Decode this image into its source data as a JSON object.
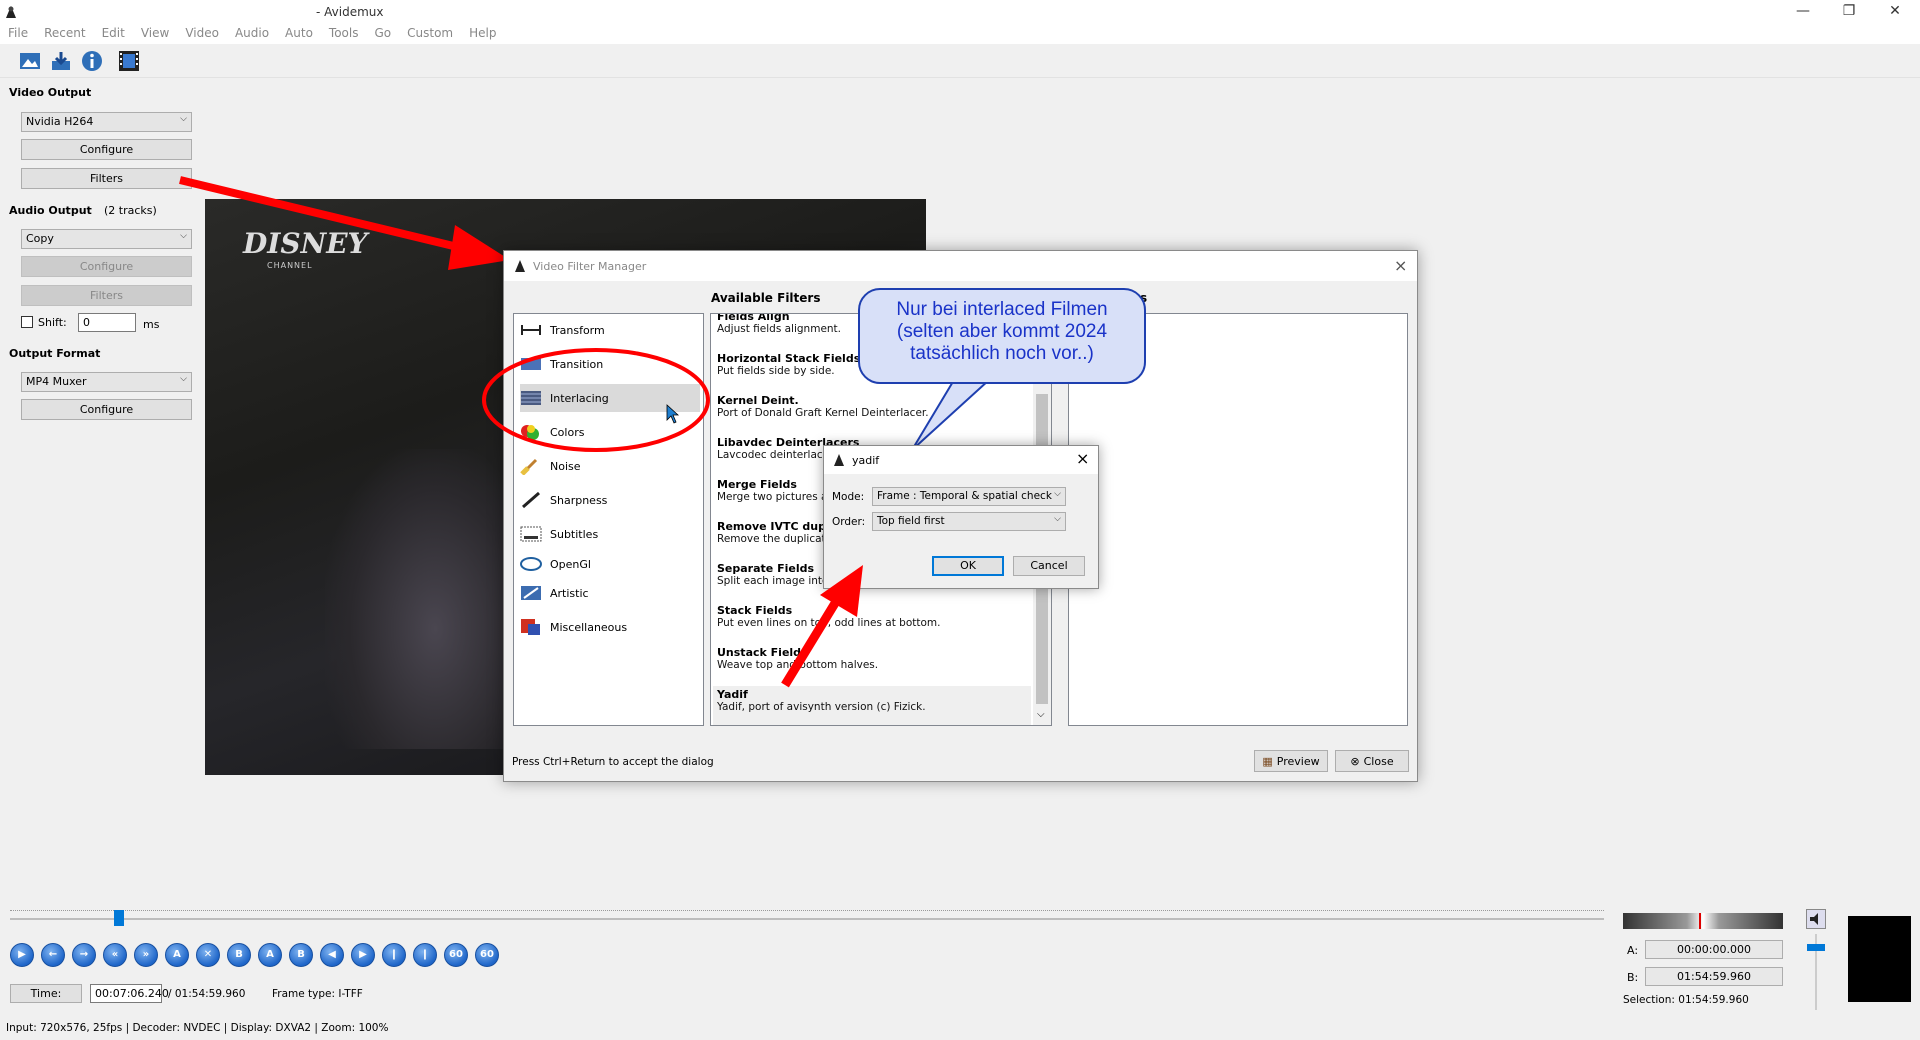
{
  "window": {
    "title": "- Avidemux",
    "minimize": "—",
    "restore": "❐",
    "close": "✕"
  },
  "menu": [
    "File",
    "Recent",
    "Edit",
    "View",
    "Video",
    "Audio",
    "Auto",
    "Tools",
    "Go",
    "Custom",
    "Help"
  ],
  "toolbar_icons": [
    "open-video-icon",
    "save-video-icon",
    "info-icon",
    "film-icon"
  ],
  "left_panel": {
    "video_output_label": "Video Output",
    "video_codec": "Nvidia H264",
    "configure": "Configure",
    "filters": "Filters",
    "audio_output_label": "Audio Output",
    "audio_tracks": "(2 tracks)",
    "audio_codec": "Copy",
    "shift_label": "Shift:",
    "shift_value": "0",
    "shift_unit": "ms",
    "output_format_label": "Output Format",
    "muxer": "MP4 Muxer"
  },
  "video": {
    "logo_top": "DISNEY",
    "logo_bottom": "CHANNEL"
  },
  "filter_manager": {
    "title": "Video Filter Manager",
    "available_header": "Available Filters",
    "active_header": "s",
    "categories": [
      "Transform",
      "Transition",
      "Interlacing",
      "Colors",
      "Noise",
      "Sharpness",
      "Subtitles",
      "OpenGl",
      "Artistic",
      "Miscellaneous"
    ],
    "selected_category": "Interlacing",
    "filters": [
      {
        "name": "Fields Align",
        "desc": "Adjust fields alignment."
      },
      {
        "name": "Horizontal Stack Fields",
        "desc": "Put fields side by side."
      },
      {
        "name": "Kernel Deint.",
        "desc": "Port of Donald Graft Kernel Deinterlacer."
      },
      {
        "name": "Libavdec Deinterlacers",
        "desc": "Lavcodec deinterlacer"
      },
      {
        "name": "Merge Fields",
        "desc": "Merge two pictures as"
      },
      {
        "name": "Remove IVTC dupe",
        "desc": "Remove the duplicate"
      },
      {
        "name": "Separate Fields",
        "desc": "Split each image into 2"
      },
      {
        "name": "Stack Fields",
        "desc": "Put even lines on top, odd lines at bottom."
      },
      {
        "name": "Unstack Fields",
        "desc": "Weave top and bottom halves."
      },
      {
        "name": "Yadif",
        "desc": "Yadif, port of avisynth version (c) Fizick."
      }
    ],
    "hint": "Press Ctrl+Return to accept the dialog",
    "preview": "Preview",
    "close": "Close"
  },
  "yadif": {
    "title": "yadif",
    "mode_label": "Mode:",
    "mode_value": "Frame : Temporal & spatial check",
    "order_label": "Order:",
    "order_value": "Top field first",
    "ok": "OK",
    "cancel": "Cancel"
  },
  "annotation": {
    "line1": "Nur bei interlaced Filmen",
    "line2": "(selten aber kommt 2024",
    "line3": "tatsächlich noch vor..)"
  },
  "playback": {
    "position_fraction": 0.065,
    "time_label": "Time:",
    "time_value": "00:07:06.240",
    "duration": "/ 01:54:59.960",
    "frame_type": "Frame type:  I-TFF",
    "a_label": "A:",
    "a_value": "00:00:00.000",
    "b_label": "B:",
    "b_value": "01:54:59.960",
    "selection": "Selection: 01:54:59.960",
    "nav_buttons": [
      "play",
      "prev",
      "next",
      "rewind",
      "fast-forward",
      "set-a",
      "clear",
      "set-b",
      "goto-a",
      "goto-b",
      "prev-keyframe",
      "next-keyframe",
      "prev-black",
      "next-black",
      "back-60",
      "fwd-60"
    ]
  },
  "status_bar": "Input: 720x576, 25fps  |  Decoder: NVDEC  |  Display: DXVA2  |  Zoom: 100%",
  "colors": {
    "accent": "#0078d7",
    "annotation_red": "#ff0000",
    "annotation_blue": "#1a33c8"
  }
}
